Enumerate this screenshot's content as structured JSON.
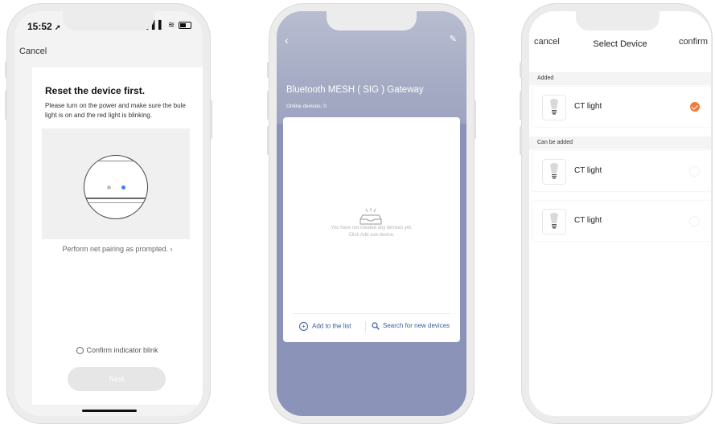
{
  "phone1": {
    "status": {
      "time": "15:52",
      "signal_icons": "▌▌▌ ≋"
    },
    "cancel": "Cancel",
    "title": "Reset the device first.",
    "description": "Please turn on the power and make sure the bule light is on and the red light is blinking.",
    "prompt_link": "Perform net pairing as prompted. ›",
    "confirm_indicator": "Confirm indicator blink",
    "next_button": "Next"
  },
  "phone2": {
    "gateway_title": "Bluetooth MESH ( SIG ) Gateway",
    "online_devices": "Online devices: 0",
    "empty_line1": "You have not created any devices yet.",
    "empty_line2": "Click Add sub device.",
    "add_to_list": "Add to the list",
    "search_devices": "Search for new devices",
    "icons": {
      "back": "back-chevron-icon",
      "edit": "edit-icon"
    }
  },
  "phone3": {
    "nav": {
      "cancel": "cancel",
      "title": "Select Device",
      "confirm": "confirm"
    },
    "sections": [
      {
        "label": "Added",
        "devices": [
          {
            "name": "CT light",
            "selected": true
          }
        ]
      },
      {
        "label": "Can be added",
        "devices": [
          {
            "name": "CT light",
            "selected": false
          },
          {
            "name": "CT light",
            "selected": false
          }
        ]
      }
    ]
  },
  "colors": {
    "accent_orange": "#f17a3a",
    "link_blue": "#3b5aa0",
    "gateway_bg": "#8b93b9",
    "indicator_blue": "#3c82e8"
  }
}
